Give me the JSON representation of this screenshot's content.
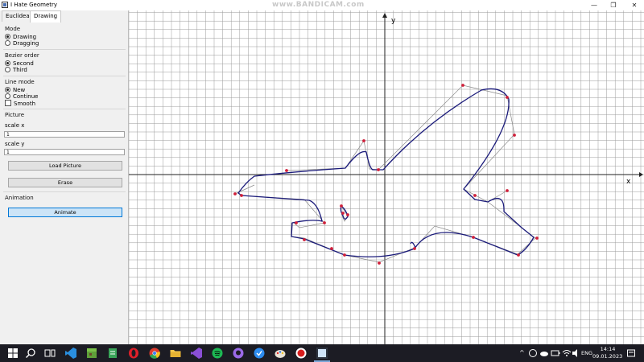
{
  "window": {
    "title": "I Hate Geometry",
    "watermark": "www.BANDICAM.com",
    "min_glyph": "—",
    "max_glyph": "❐",
    "close_glyph": "✕"
  },
  "tabs": [
    {
      "label": "Euclidean",
      "active": false
    },
    {
      "label": "Drawing",
      "active": true
    }
  ],
  "panel": {
    "mode": {
      "title": "Mode",
      "options": [
        "Drawing",
        "Dragging"
      ],
      "selected": "Drawing"
    },
    "bezier": {
      "title": "Bezier order",
      "options": [
        "Second",
        "Third"
      ],
      "selected": "Second"
    },
    "line_mode": {
      "title": "Line mode",
      "options": [
        "New",
        "Continue"
      ],
      "selected": "New",
      "checkbox": "Smooth",
      "checkbox_checked": false
    },
    "picture": {
      "title": "Picture",
      "scale_x_label": "scale x",
      "scale_x_value": "1",
      "scale_y_label": "scale y",
      "scale_y_value": "1",
      "load_button": "Load Picture",
      "erase_button": "Erase"
    },
    "animation": {
      "title": "Animation",
      "animate_button": "Animate"
    }
  },
  "canvas": {
    "x_axis_label": "x",
    "y_axis_label": "y",
    "grid": true,
    "curve_color": "#1a1a7a",
    "control_color": "#888888",
    "point_color": "#d0203a"
  },
  "taskbar": {
    "icons": [
      "windows-start-icon",
      "search-icon",
      "task-view-icon",
      "vscode-icon",
      "minecraft-icon",
      "notepad-icon",
      "opera-icon",
      "chrome-icon",
      "file-explorer-icon",
      "visual-studio-icon",
      "spotify-icon",
      "github-icon",
      "vpn-icon",
      "paint-icon",
      "bandicam-icon",
      "app-icon"
    ],
    "language": "ENG",
    "time": "14:14",
    "date": "09.01.2023"
  }
}
